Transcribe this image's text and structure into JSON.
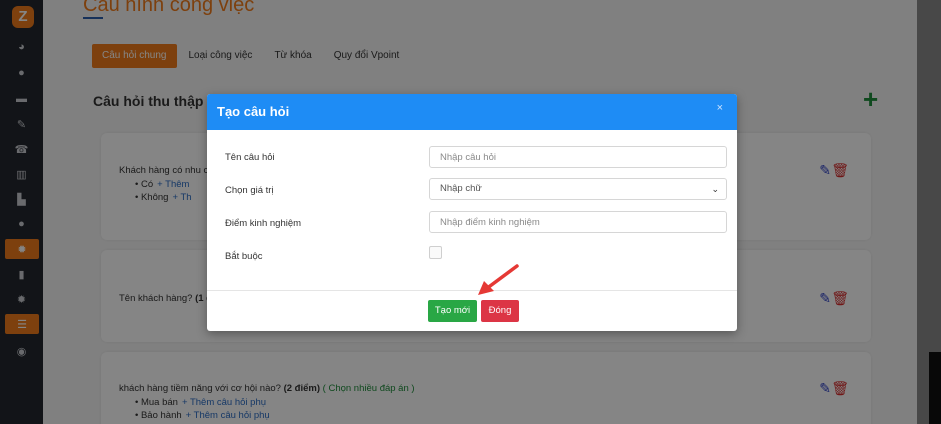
{
  "sidebar": {
    "logo": "Z",
    "items": [
      {
        "icon": "dashboard-icon",
        "glyph": "◕"
      },
      {
        "icon": "user-icon",
        "glyph": "●"
      },
      {
        "icon": "briefcase-icon",
        "glyph": "▬"
      },
      {
        "icon": "edit-icon",
        "glyph": "✎"
      },
      {
        "icon": "phone-icon",
        "glyph": "☎"
      },
      {
        "icon": "chart-icon",
        "glyph": "▥"
      },
      {
        "icon": "handshake-icon",
        "glyph": "▙"
      },
      {
        "icon": "user-tie-icon",
        "glyph": "●"
      },
      {
        "icon": "gear-icon",
        "glyph": "✹"
      },
      {
        "icon": "building-icon",
        "glyph": "▮"
      },
      {
        "icon": "settings-icon",
        "glyph": "✹"
      },
      {
        "icon": "list-icon",
        "glyph": "☰"
      },
      {
        "icon": "account-icon",
        "glyph": "◉"
      }
    ]
  },
  "page": {
    "title": "Cấu hình công việc",
    "tabs": [
      {
        "label": "Câu hỏi chung",
        "active": true
      },
      {
        "label": "Loại công việc",
        "active": false
      },
      {
        "label": "Từ khóa",
        "active": false
      },
      {
        "label": "Quy đổi Vpoint",
        "active": false
      }
    ],
    "section_title": "Câu hỏi thu thập c",
    "add_glyph": "+",
    "cards": [
      {
        "text": "Khách hàng có nhu c",
        "bullets": [
          {
            "label": "Có",
            "sub": "+ Thêm"
          },
          {
            "label": "Không",
            "sub": "+ Th"
          }
        ]
      },
      {
        "text": "Tên khách hàng?",
        "points": "(1 đ",
        "bullets": []
      },
      {
        "text": "khách hàng tiềm năng với cơ hội nào?",
        "points": "(2 điểm)",
        "tag": "( Chọn nhiều đáp án )",
        "bullets": [
          {
            "label": "Mua bán",
            "sub": "+ Thêm câu hỏi phụ"
          },
          {
            "label": "Bảo hành",
            "sub": "+ Thêm câu hỏi phụ"
          }
        ]
      }
    ],
    "edit_glyph": "✎",
    "delete_glyph": "🗑"
  },
  "modal": {
    "title": "Tạo câu hỏi",
    "close": "×",
    "fields": [
      {
        "label": "Tên câu hỏi",
        "placeholder": "Nhập câu hỏi"
      },
      {
        "label": "Chọn giá trị",
        "value": "Nhập chữ"
      },
      {
        "label": "Điểm kinh nghiệm",
        "placeholder": "Nhập điểm kinh nghiệm"
      },
      {
        "label": "Bắt buộc"
      }
    ],
    "chevron": "⌄",
    "create_label": "Tạo mới",
    "close_label": "Đóng"
  },
  "colors": {
    "accent": "#f07c1b",
    "modal_header": "#1e8cf5",
    "create_button": "#29a745",
    "close_button": "#dc3545"
  }
}
